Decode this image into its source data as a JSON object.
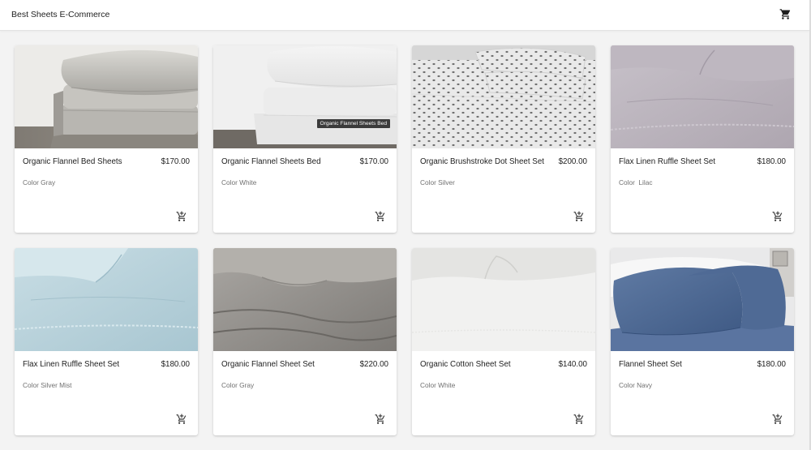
{
  "app": {
    "title": "Best Sheets E-Commerce"
  },
  "header": {
    "cart_icon": "shopping-cart-icon"
  },
  "products": [
    {
      "name": "Organic Flannel Bed Sheets",
      "price": "$170.00",
      "color": "Color Gray",
      "image": "gray-flannel-sheets"
    },
    {
      "name": "Organic Flannel Sheets Bed",
      "price": "$170.00",
      "color": "Color White",
      "image": "white-flannel-sheets",
      "image_caption": "Organic Flannel Sheets Bed"
    },
    {
      "name": "Organic Brushstroke Dot Sheet Set",
      "price": "$200.00",
      "color": "Color Silver",
      "image": "dot-print-sheets"
    },
    {
      "name": "Flax Linen Ruffle Sheet Set",
      "price": "$180.00",
      "color": "Color  Lilac",
      "image": "lilac-linen-sheets"
    },
    {
      "name": "Flax Linen Ruffle Sheet Set",
      "price": "$180.00",
      "color": "Color Silver Mist",
      "image": "silver-mist-linen-sheets"
    },
    {
      "name": "Organic Flannel Sheet Set",
      "price": "$220.00",
      "color": "Color Gray",
      "image": "gray-flannel-bed"
    },
    {
      "name": "Organic Cotton Sheet Set",
      "price": "$140.00",
      "color": "Color White",
      "image": "white-cotton-sheets"
    },
    {
      "name": "Flannel Sheet Set",
      "price": "$180.00",
      "color": "Color Navy",
      "image": "navy-flannel-pillows"
    }
  ],
  "card_icon": "add-shopping-cart-icon"
}
